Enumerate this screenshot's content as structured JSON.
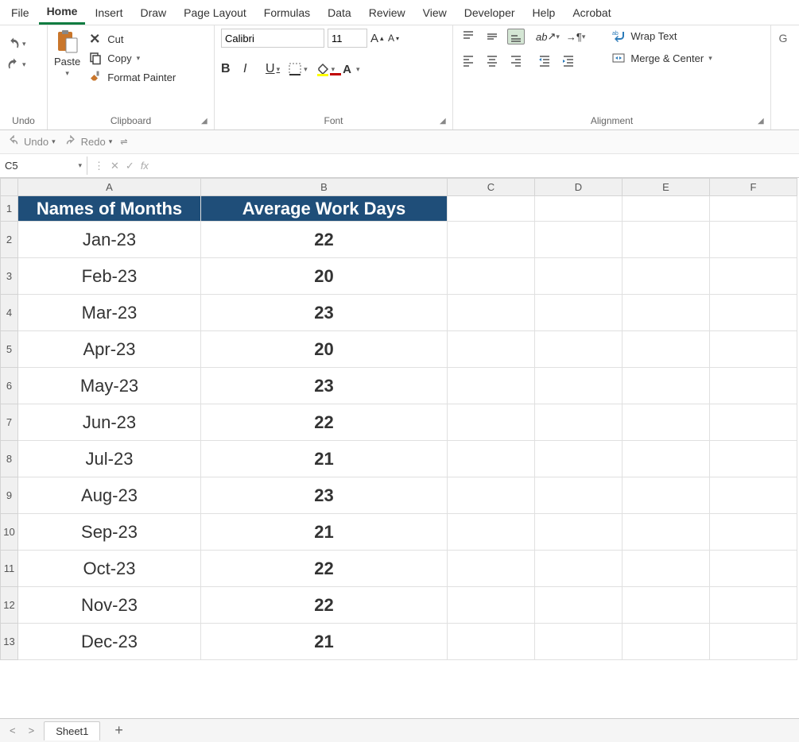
{
  "menu": {
    "file": "File",
    "home": "Home",
    "insert": "Insert",
    "draw": "Draw",
    "page_layout": "Page Layout",
    "formulas": "Formulas",
    "data": "Data",
    "review": "Review",
    "view": "View",
    "developer": "Developer",
    "help": "Help",
    "acrobat": "Acrobat"
  },
  "ribbon": {
    "undo_group": "Undo",
    "clipboard_group": "Clipboard",
    "font_group": "Font",
    "alignment_group": "Alignment",
    "paste": "Paste",
    "cut": "Cut",
    "copy": "Copy",
    "format_painter": "Format Painter",
    "font_name": "Calibri",
    "font_size": "11",
    "wrap_text": "Wrap Text",
    "merge_center": "Merge & Center"
  },
  "qat": {
    "undo": "Undo",
    "redo": "Redo"
  },
  "namebox": "C5",
  "formula": "",
  "columns": [
    "A",
    "B",
    "C",
    "D",
    "E",
    "F"
  ],
  "headers": {
    "a": "Names of Months",
    "b": "Average Work Days"
  },
  "rows": [
    {
      "n": 1,
      "a": "",
      "b": ""
    },
    {
      "n": 2,
      "a": "Jan-23",
      "b": "22"
    },
    {
      "n": 3,
      "a": "Feb-23",
      "b": "20"
    },
    {
      "n": 4,
      "a": "Mar-23",
      "b": "23"
    },
    {
      "n": 5,
      "a": "Apr-23",
      "b": "20"
    },
    {
      "n": 6,
      "a": "May-23",
      "b": "23"
    },
    {
      "n": 7,
      "a": "Jun-23",
      "b": "22"
    },
    {
      "n": 8,
      "a": "Jul-23",
      "b": "21"
    },
    {
      "n": 9,
      "a": "Aug-23",
      "b": "23"
    },
    {
      "n": 10,
      "a": "Sep-23",
      "b": "21"
    },
    {
      "n": 11,
      "a": "Oct-23",
      "b": "22"
    },
    {
      "n": 12,
      "a": "Nov-23",
      "b": "22"
    },
    {
      "n": 13,
      "a": "Dec-23",
      "b": "21"
    }
  ],
  "sheet_tab": "Sheet1"
}
